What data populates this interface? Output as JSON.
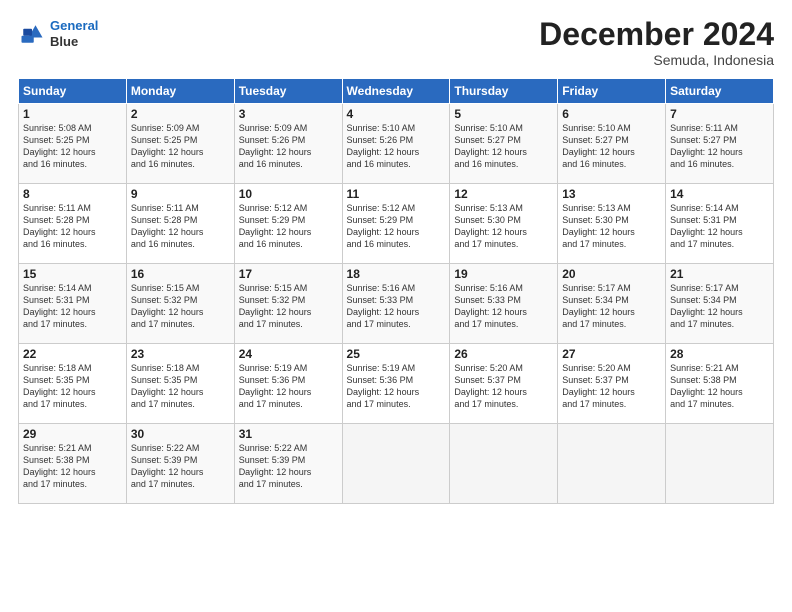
{
  "logo": {
    "line1": "General",
    "line2": "Blue"
  },
  "header": {
    "title": "December 2024",
    "subtitle": "Semuda, Indonesia"
  },
  "weekdays": [
    "Sunday",
    "Monday",
    "Tuesday",
    "Wednesday",
    "Thursday",
    "Friday",
    "Saturday"
  ],
  "weeks": [
    [
      {
        "day": "1",
        "info": "Sunrise: 5:08 AM\nSunset: 5:25 PM\nDaylight: 12 hours\nand 16 minutes."
      },
      {
        "day": "2",
        "info": "Sunrise: 5:09 AM\nSunset: 5:25 PM\nDaylight: 12 hours\nand 16 minutes."
      },
      {
        "day": "3",
        "info": "Sunrise: 5:09 AM\nSunset: 5:26 PM\nDaylight: 12 hours\nand 16 minutes."
      },
      {
        "day": "4",
        "info": "Sunrise: 5:10 AM\nSunset: 5:26 PM\nDaylight: 12 hours\nand 16 minutes."
      },
      {
        "day": "5",
        "info": "Sunrise: 5:10 AM\nSunset: 5:27 PM\nDaylight: 12 hours\nand 16 minutes."
      },
      {
        "day": "6",
        "info": "Sunrise: 5:10 AM\nSunset: 5:27 PM\nDaylight: 12 hours\nand 16 minutes."
      },
      {
        "day": "7",
        "info": "Sunrise: 5:11 AM\nSunset: 5:27 PM\nDaylight: 12 hours\nand 16 minutes."
      }
    ],
    [
      {
        "day": "8",
        "info": "Sunrise: 5:11 AM\nSunset: 5:28 PM\nDaylight: 12 hours\nand 16 minutes."
      },
      {
        "day": "9",
        "info": "Sunrise: 5:11 AM\nSunset: 5:28 PM\nDaylight: 12 hours\nand 16 minutes."
      },
      {
        "day": "10",
        "info": "Sunrise: 5:12 AM\nSunset: 5:29 PM\nDaylight: 12 hours\nand 16 minutes."
      },
      {
        "day": "11",
        "info": "Sunrise: 5:12 AM\nSunset: 5:29 PM\nDaylight: 12 hours\nand 16 minutes."
      },
      {
        "day": "12",
        "info": "Sunrise: 5:13 AM\nSunset: 5:30 PM\nDaylight: 12 hours\nand 17 minutes."
      },
      {
        "day": "13",
        "info": "Sunrise: 5:13 AM\nSunset: 5:30 PM\nDaylight: 12 hours\nand 17 minutes."
      },
      {
        "day": "14",
        "info": "Sunrise: 5:14 AM\nSunset: 5:31 PM\nDaylight: 12 hours\nand 17 minutes."
      }
    ],
    [
      {
        "day": "15",
        "info": "Sunrise: 5:14 AM\nSunset: 5:31 PM\nDaylight: 12 hours\nand 17 minutes."
      },
      {
        "day": "16",
        "info": "Sunrise: 5:15 AM\nSunset: 5:32 PM\nDaylight: 12 hours\nand 17 minutes."
      },
      {
        "day": "17",
        "info": "Sunrise: 5:15 AM\nSunset: 5:32 PM\nDaylight: 12 hours\nand 17 minutes."
      },
      {
        "day": "18",
        "info": "Sunrise: 5:16 AM\nSunset: 5:33 PM\nDaylight: 12 hours\nand 17 minutes."
      },
      {
        "day": "19",
        "info": "Sunrise: 5:16 AM\nSunset: 5:33 PM\nDaylight: 12 hours\nand 17 minutes."
      },
      {
        "day": "20",
        "info": "Sunrise: 5:17 AM\nSunset: 5:34 PM\nDaylight: 12 hours\nand 17 minutes."
      },
      {
        "day": "21",
        "info": "Sunrise: 5:17 AM\nSunset: 5:34 PM\nDaylight: 12 hours\nand 17 minutes."
      }
    ],
    [
      {
        "day": "22",
        "info": "Sunrise: 5:18 AM\nSunset: 5:35 PM\nDaylight: 12 hours\nand 17 minutes."
      },
      {
        "day": "23",
        "info": "Sunrise: 5:18 AM\nSunset: 5:35 PM\nDaylight: 12 hours\nand 17 minutes."
      },
      {
        "day": "24",
        "info": "Sunrise: 5:19 AM\nSunset: 5:36 PM\nDaylight: 12 hours\nand 17 minutes."
      },
      {
        "day": "25",
        "info": "Sunrise: 5:19 AM\nSunset: 5:36 PM\nDaylight: 12 hours\nand 17 minutes."
      },
      {
        "day": "26",
        "info": "Sunrise: 5:20 AM\nSunset: 5:37 PM\nDaylight: 12 hours\nand 17 minutes."
      },
      {
        "day": "27",
        "info": "Sunrise: 5:20 AM\nSunset: 5:37 PM\nDaylight: 12 hours\nand 17 minutes."
      },
      {
        "day": "28",
        "info": "Sunrise: 5:21 AM\nSunset: 5:38 PM\nDaylight: 12 hours\nand 17 minutes."
      }
    ],
    [
      {
        "day": "29",
        "info": "Sunrise: 5:21 AM\nSunset: 5:38 PM\nDaylight: 12 hours\nand 17 minutes."
      },
      {
        "day": "30",
        "info": "Sunrise: 5:22 AM\nSunset: 5:39 PM\nDaylight: 12 hours\nand 17 minutes."
      },
      {
        "day": "31",
        "info": "Sunrise: 5:22 AM\nSunset: 5:39 PM\nDaylight: 12 hours\nand 17 minutes."
      },
      {
        "day": "",
        "info": ""
      },
      {
        "day": "",
        "info": ""
      },
      {
        "day": "",
        "info": ""
      },
      {
        "day": "",
        "info": ""
      }
    ]
  ]
}
